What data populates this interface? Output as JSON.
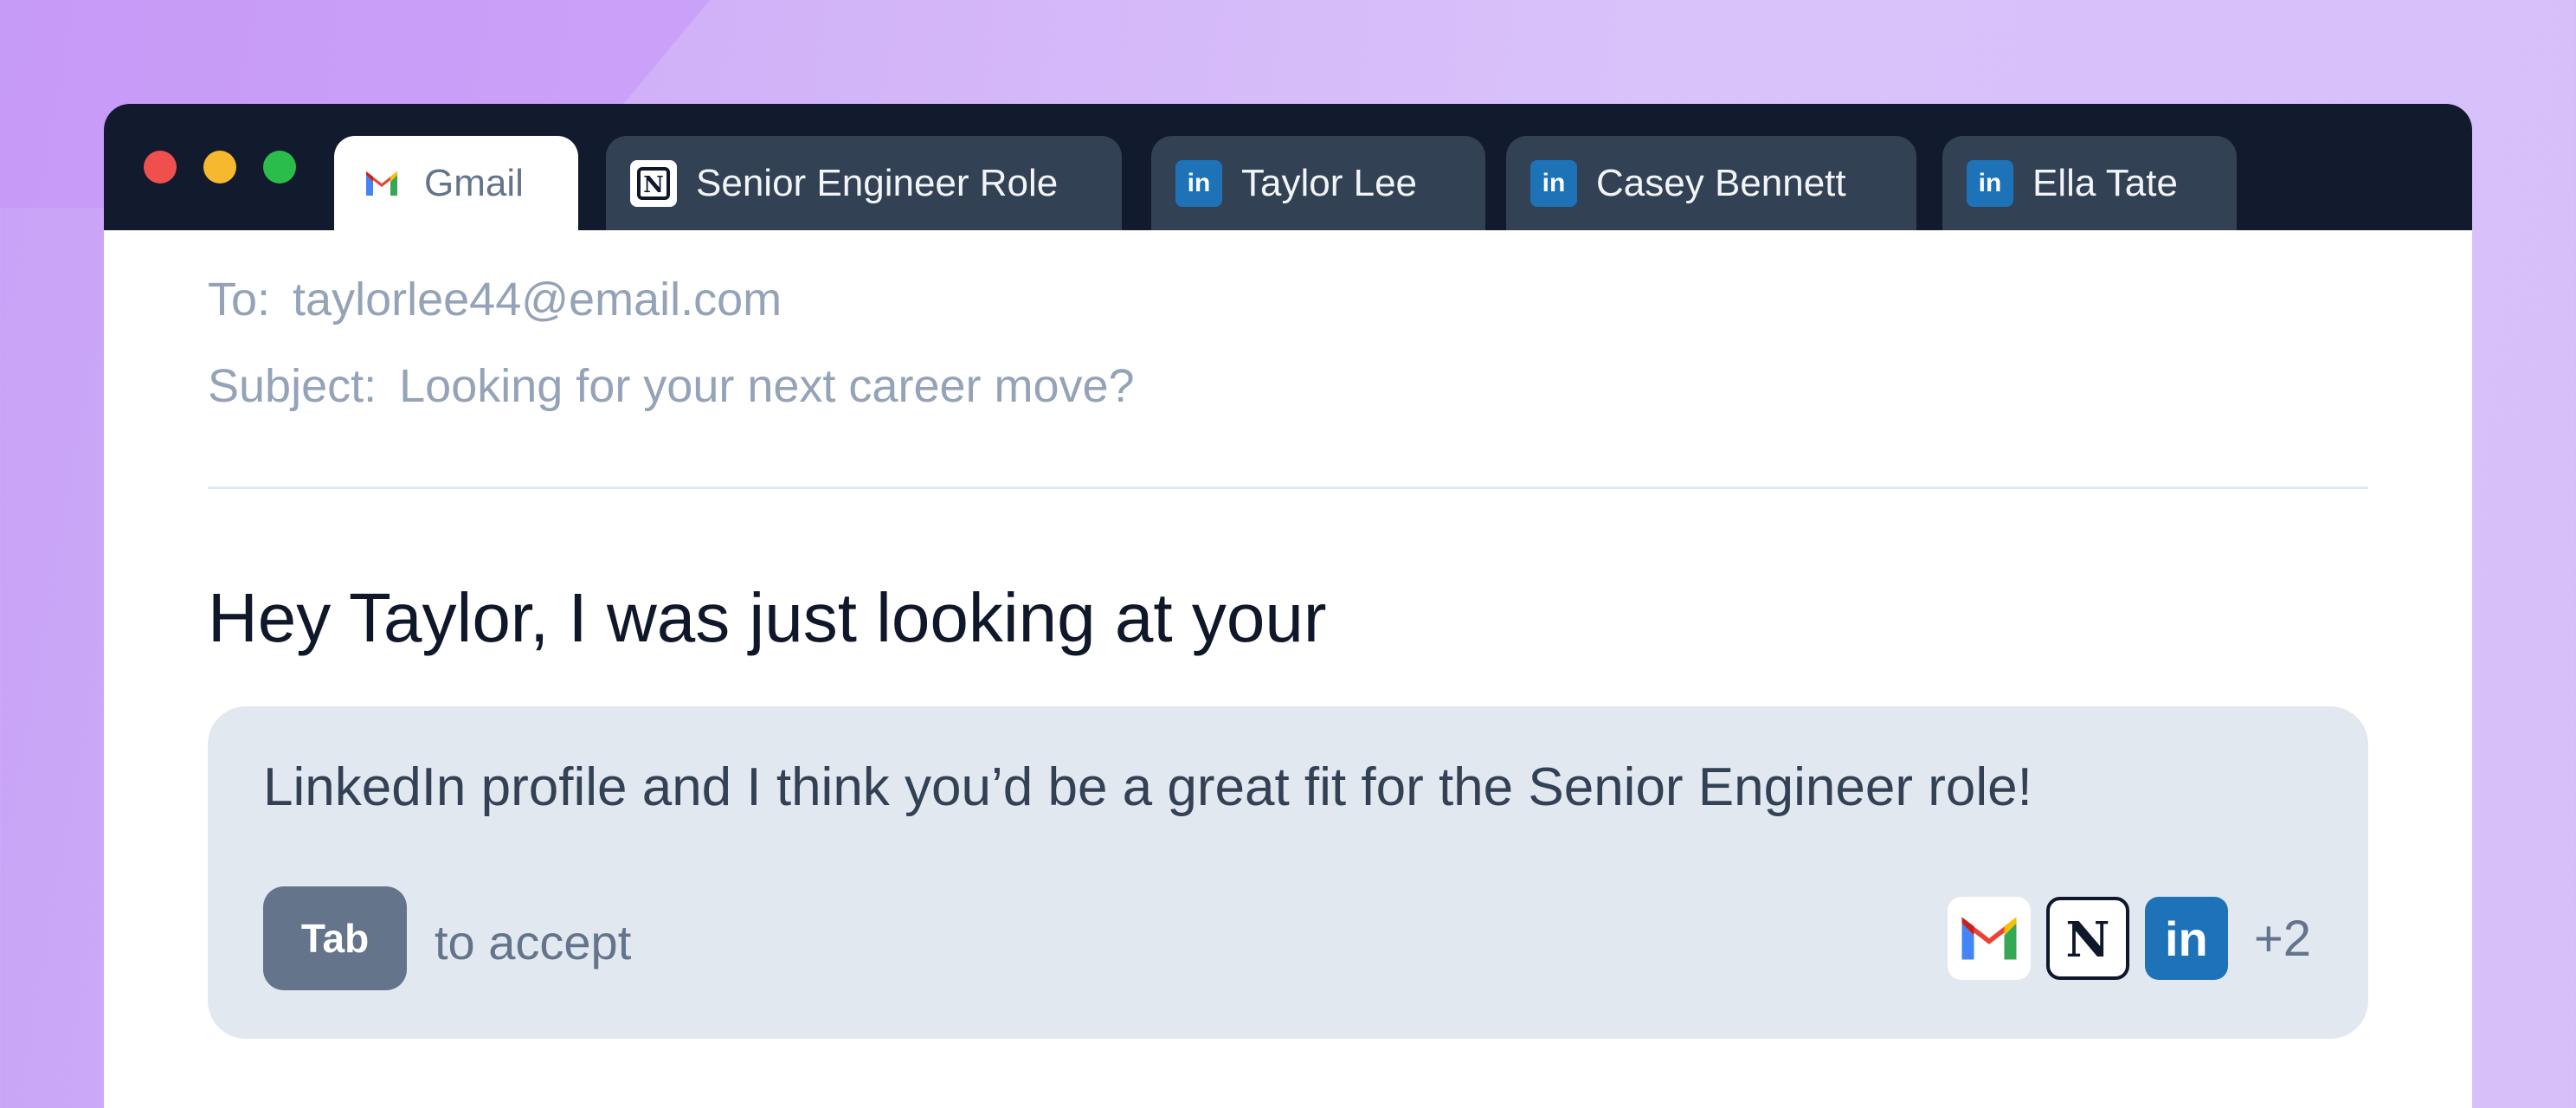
{
  "window": {
    "controls": [
      "close",
      "minimize",
      "maximize"
    ]
  },
  "tabs": [
    {
      "label": "Gmail",
      "icon": "gmail-icon",
      "active": true
    },
    {
      "label": "Senior Engineer Role",
      "icon": "notion-icon",
      "active": false
    },
    {
      "label": "Taylor Lee",
      "icon": "linkedin-icon",
      "active": false
    },
    {
      "label": "Casey Bennett",
      "icon": "linkedin-icon",
      "active": false
    },
    {
      "label": "Ella Tate",
      "icon": "linkedin-icon",
      "active": false
    }
  ],
  "linkedin_badge_text": "in",
  "compose": {
    "to_label": "To:",
    "to_value": "taylorlee44@email.com",
    "subject_label": "Subject:",
    "subject_value": "Looking for your next career move?",
    "body": "Hey Taylor, I was just looking at your"
  },
  "suggestion": {
    "text": "LinkedIn profile and I think you’d be a great fit for the Senior Engineer role!",
    "key_label": "Tab",
    "hint": "to accept",
    "sources": [
      "gmail-icon",
      "notion-icon",
      "linkedin-icon"
    ],
    "more_count": "+2"
  },
  "colors": {
    "titlebar": "#111b2d",
    "tab_inactive": "#334155",
    "linkedin": "#1d72b8",
    "suggestion_bg": "#e2e8f0",
    "key_bg": "#64748b"
  }
}
